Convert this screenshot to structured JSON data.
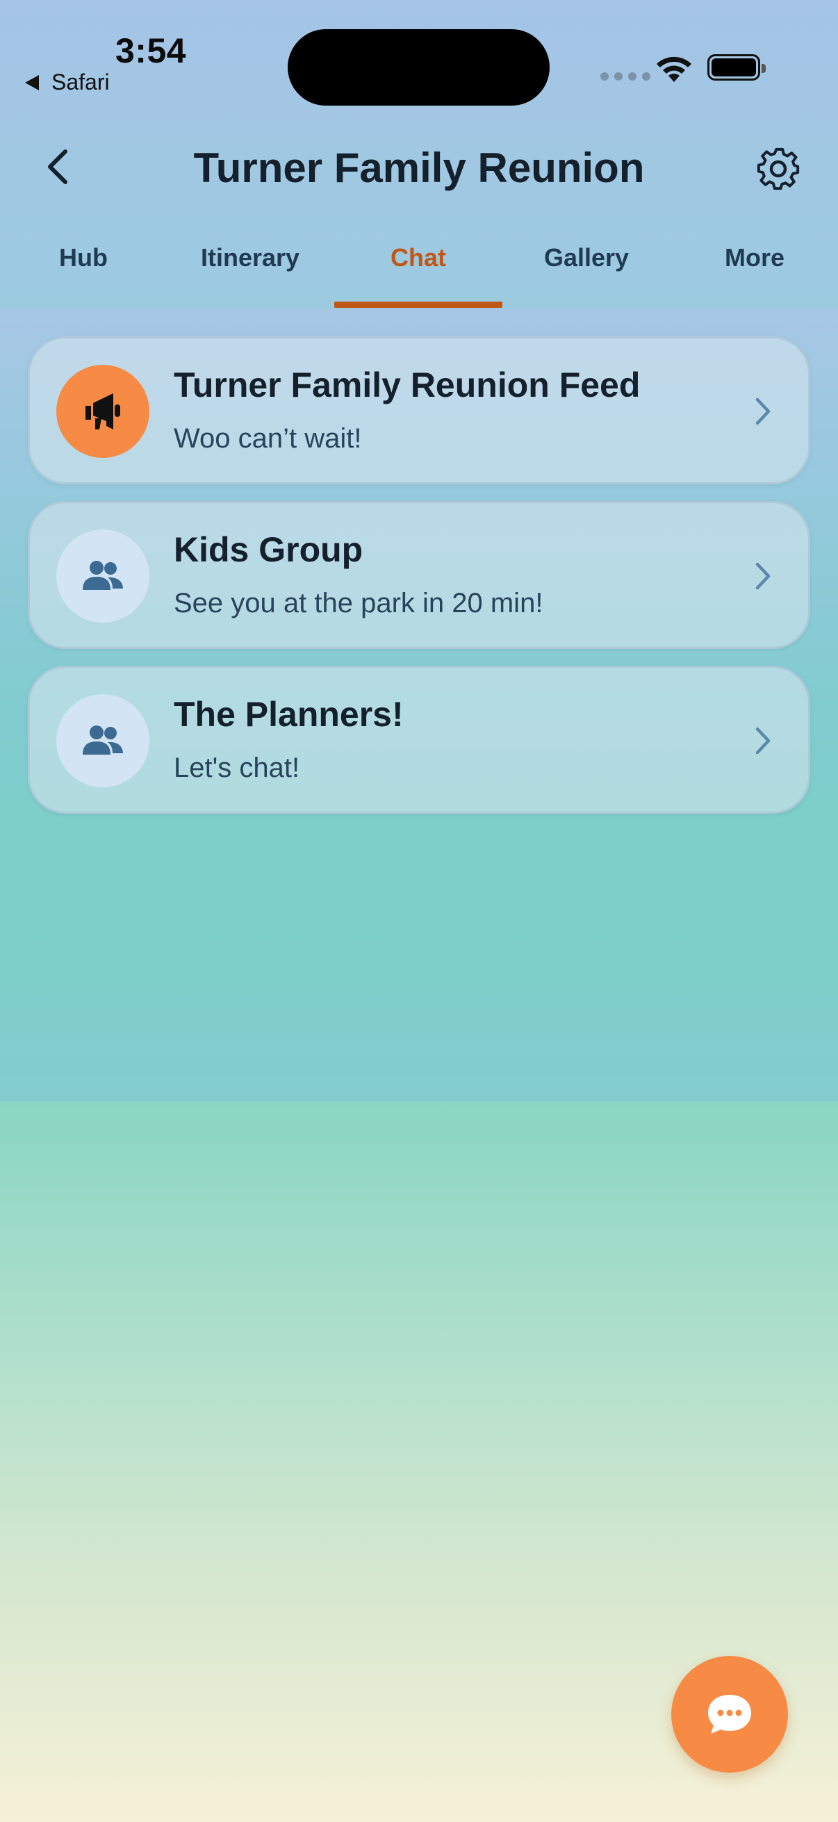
{
  "status_bar": {
    "time": "3:54",
    "back_app": "Safari"
  },
  "header": {
    "title": "Turner Family Reunion",
    "back_icon": "chevron-left-icon",
    "settings_icon": "gear-icon"
  },
  "tabs": [
    {
      "label": "Hub",
      "active": false
    },
    {
      "label": "Itinerary",
      "active": false
    },
    {
      "label": "Chat",
      "active": true
    },
    {
      "label": "Gallery",
      "active": false
    },
    {
      "label": "More",
      "active": false
    }
  ],
  "chats": [
    {
      "title": "Turner Family Reunion Feed",
      "subtitle": "Woo can’t wait!",
      "icon": "megaphone-icon",
      "avatar_color": "#f78b45"
    },
    {
      "title": "Kids Group",
      "subtitle": "See you at the park in 20 min!",
      "icon": "people-icon",
      "avatar_color": "#d3e5f4"
    },
    {
      "title": "The Planners!",
      "subtitle": "Let's chat!",
      "icon": "people-icon",
      "avatar_color": "#d3e5f4"
    }
  ],
  "fab": {
    "icon": "chat-bubble-icon",
    "color": "#f78b45"
  },
  "colors": {
    "accent": "#c05716",
    "title": "#14202c",
    "tab_text": "#1f3a52"
  }
}
